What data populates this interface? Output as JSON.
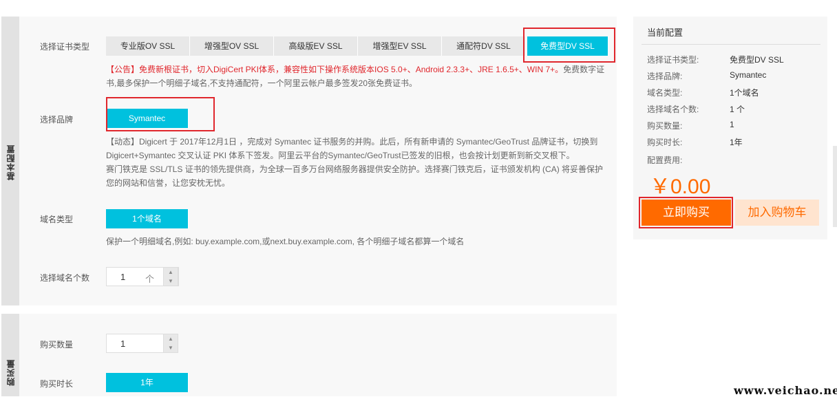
{
  "sections": {
    "basic": "基本配置",
    "purchase": "购买量"
  },
  "cert_type": {
    "label": "选择证书类型",
    "options": [
      "专业版OV SSL",
      "增强型OV SSL",
      "高级版EV SSL",
      "增强型EV SSL",
      "通配符DV SSL",
      "免费型DV SSL"
    ],
    "selected": "免费型DV SSL",
    "notice_red": "【公告】免费新根证书，切入DigiCert PKI体系，兼容性如下操作系统版本IOS 5.0+、Android 2.3.3+、JRE 1.6.5+、WIN 7+。",
    "notice_gray": "免费数字证书,最多保护一个明细子域名,不支持通配符，一个阿里云帐户最多签发20张免费证书。"
  },
  "brand": {
    "label": "选择品牌",
    "option": "Symantec",
    "desc_line1": "【动态】Digicert 于 2017年12月1日 ，完成对 Symantec 证书服务的并购。此后，所有新申请的 Symantec/GeoTrust 品牌证书，切换到",
    "desc_line2": "Digicert+Symantec 交叉认证 PKI 体系下签发。阿里云平台的Symantec/GeoTrust已签发的旧根，也会按计划更新到新交叉根下。",
    "desc_line3": "赛门铁克是 SSL/TLS 证书的领先提供商，为全球一百多万台网络服务器提供安全防护。选择赛门铁克后，证书颁发机构 (CA) 将妥善保护",
    "desc_line4": "您的网站和信誉，让您安枕无忧。"
  },
  "domain_type": {
    "label": "域名类型",
    "option": "1个域名",
    "hint": "保护一个明细域名,例如: buy.example.com,或next.buy.example.com, 各个明细子域名都算一个域名"
  },
  "domain_count": {
    "label": "选择域名个数",
    "value": "1",
    "unit": "个"
  },
  "quantity": {
    "label": "购买数量",
    "value": "1"
  },
  "duration": {
    "label": "购买时长",
    "option": "1年"
  },
  "summary": {
    "title": "当前配置",
    "rows": [
      {
        "label": "选择证书类型:",
        "value": "免费型DV SSL"
      },
      {
        "label": "选择品牌:",
        "value": "Symantec"
      },
      {
        "label": "域名类型:",
        "value": "1个域名"
      },
      {
        "label": "选择域名个数:",
        "value": "1 个"
      },
      {
        "label": "购买数量:",
        "value": "1"
      },
      {
        "label": "购买时长:",
        "value": "1年"
      }
    ],
    "fee_label": "配置费用:",
    "price": "￥0.00",
    "buy_label": "立即购买",
    "cart_label": "加入购物车"
  },
  "watermark": "www.veichao.net",
  "colors": {
    "accent": "#00c1de",
    "highlight": "#e0262c",
    "price": "#ff6a00"
  }
}
